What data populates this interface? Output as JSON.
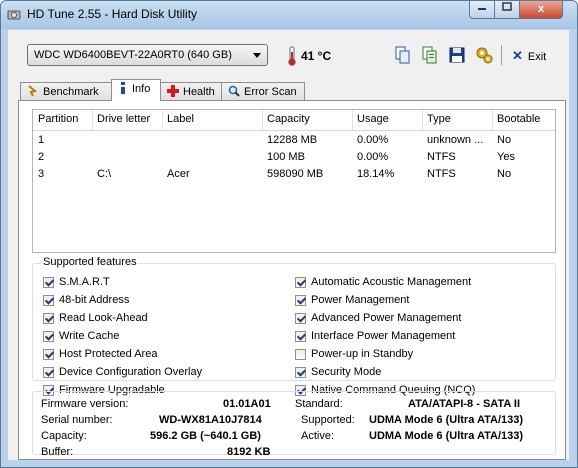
{
  "window": {
    "title": "HD Tune 2.55 - Hard Disk Utility"
  },
  "caption_buttons": {
    "close": "x"
  },
  "toolbar": {
    "drive": "WDC WD6400BEVT-22A0RT0 (640 GB)",
    "temperature": "41 °C",
    "exit_label": "Exit",
    "exit_icon": "x-icon"
  },
  "tabs": [
    {
      "label": "Benchmark",
      "icon": "benchmark-icon",
      "active": false
    },
    {
      "label": "Info",
      "icon": "info-icon",
      "active": true
    },
    {
      "label": "Health",
      "icon": "health-cross-icon",
      "active": false
    },
    {
      "label": "Error Scan",
      "icon": "magnifier-icon",
      "active": false
    }
  ],
  "partitions": {
    "columns": [
      "Partition",
      "Drive letter",
      "Label",
      "Capacity",
      "Usage",
      "Type",
      "Bootable"
    ],
    "rows": [
      {
        "partition": "1",
        "drive_letter": "",
        "label": "",
        "capacity": "12288 MB",
        "usage": "0.00%",
        "type": "unknown ...",
        "bootable": "No"
      },
      {
        "partition": "2",
        "drive_letter": "",
        "label": "",
        "capacity": "100 MB",
        "usage": "0.00%",
        "type": "NTFS",
        "bootable": "Yes"
      },
      {
        "partition": "3",
        "drive_letter": "C:\\",
        "label": "Acer",
        "capacity": "598090 MB",
        "usage": "18.14%",
        "type": "NTFS",
        "bootable": "No"
      }
    ]
  },
  "features": {
    "title": "Supported features",
    "left": [
      {
        "label": "S.M.A.R.T",
        "checked": true
      },
      {
        "label": "48-bit Address",
        "checked": true
      },
      {
        "label": "Read Look-Ahead",
        "checked": true
      },
      {
        "label": "Write Cache",
        "checked": true
      },
      {
        "label": "Host Protected Area",
        "checked": true
      },
      {
        "label": "Device Configuration Overlay",
        "checked": true
      },
      {
        "label": "Firmware Upgradable",
        "checked": true
      }
    ],
    "right": [
      {
        "label": "Automatic Acoustic Management",
        "checked": true
      },
      {
        "label": "Power Management",
        "checked": true
      },
      {
        "label": "Advanced Power Management",
        "checked": true
      },
      {
        "label": "Interface Power Management",
        "checked": true
      },
      {
        "label": "Power-up in Standby",
        "checked": false
      },
      {
        "label": "Security Mode",
        "checked": true
      },
      {
        "label": "Native Command Queuing (NCQ)",
        "checked": true
      }
    ]
  },
  "info": {
    "firmware_label": "Firmware version:",
    "firmware": "01.01A01",
    "serial_label": "Serial number:",
    "serial": "WD-WX81A10J7814",
    "capacity_label": "Capacity:",
    "capacity": "596.2 GB (~640.1 GB)",
    "buffer_label": "Buffer:",
    "buffer": "8192 KB",
    "standard_label": "Standard:",
    "standard": "ATA/ATAPI-8 - SATA II",
    "supported_label": "Supported:",
    "supported": "UDMA Mode 6 (Ultra ATA/133)",
    "active_label": "Active:",
    "active": "UDMA Mode 6 (Ultra ATA/133)"
  }
}
